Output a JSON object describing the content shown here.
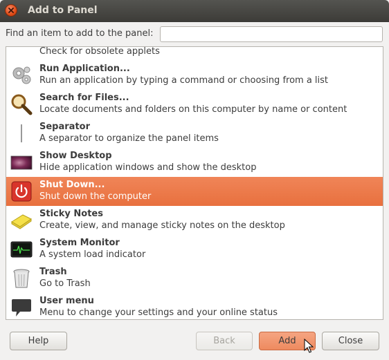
{
  "window": {
    "title": "Add to Panel"
  },
  "find": {
    "label": "Find an item to add to the panel:",
    "value": "",
    "placeholder": ""
  },
  "items": [
    {
      "name": "",
      "desc": "Check for obsolete applets",
      "icon": "partial-icon"
    },
    {
      "name": "Run Application...",
      "desc": "Run an application by typing a command or choosing from a list",
      "icon": "gears-icon"
    },
    {
      "name": "Search for Files...",
      "desc": "Locate documents and folders on this computer by name or content",
      "icon": "magnifier-icon"
    },
    {
      "name": "Separator",
      "desc": "A separator to organize the panel items",
      "icon": "separator-icon"
    },
    {
      "name": "Show Desktop",
      "desc": "Hide application windows and show the desktop",
      "icon": "desktop-icon"
    },
    {
      "name": "Shut Down...",
      "desc": "Shut down the computer",
      "icon": "power-icon",
      "selected": true
    },
    {
      "name": "Sticky Notes",
      "desc": "Create, view, and manage sticky notes on the desktop",
      "icon": "sticky-notes-icon"
    },
    {
      "name": "System Monitor",
      "desc": "A system load indicator",
      "icon": "system-monitor-icon"
    },
    {
      "name": "Trash",
      "desc": "Go to Trash",
      "icon": "trash-icon"
    },
    {
      "name": "User menu",
      "desc": "Menu to change your settings and your online status",
      "icon": "speech-bubble-icon"
    }
  ],
  "buttons": {
    "help": "Help",
    "back": "Back",
    "add": "Add",
    "close": "Close"
  },
  "colors": {
    "selection": "#e8703e",
    "titlebar": "#3c3b37"
  }
}
